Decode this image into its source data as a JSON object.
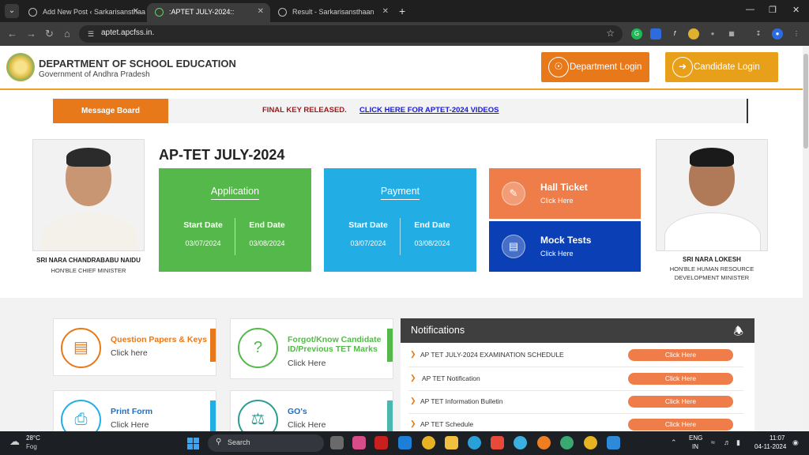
{
  "browser": {
    "tabs": [
      {
        "label": "Add New Post ‹ Sarkarisansthaan"
      },
      {
        "label": ":APTET JULY-2024::"
      },
      {
        "label": "Result - Sarkarisansthaan"
      }
    ],
    "url": "aptet.apcfss.in."
  },
  "header": {
    "department": "DEPARTMENT OF SCHOOL EDUCATION",
    "government": "Government of Andhra Pradesh",
    "department_login": "Department Login",
    "candidate_login": "Candidate Login"
  },
  "message_board": {
    "label": "Message Board",
    "notice": "FINAL KEY RELEASED.",
    "link": "CLICK HERE FOR APTET-2024 VIDEOS"
  },
  "left_person": {
    "name": "SRI NARA CHANDRABABU NAIDU",
    "role": "HON'BLE CHIEF MINISTER"
  },
  "right_person": {
    "name": "SRI NARA LOKESH",
    "role_line1": "HON'BLE HUMAN RESOURCE",
    "role_line2": "DEVELOPMENT MINISTER"
  },
  "exam_title": "AP-TET JULY-2024",
  "application": {
    "title": "Application",
    "start_label": "Start Date",
    "end_label": "End Date",
    "start": "03/07/2024",
    "end": "03/08/2024"
  },
  "payment": {
    "title": "Payment",
    "start_label": "Start Date",
    "end_label": "End Date",
    "start": "03/07/2024",
    "end": "03/08/2024"
  },
  "hall_ticket": {
    "title": "Hall Ticket",
    "sub": "Click Here"
  },
  "mock_tests": {
    "title": "Mock Tests",
    "sub": "Click Here"
  },
  "quick_links": {
    "question_papers": {
      "title": "Question Papers & Keys",
      "sub": "Click here"
    },
    "forgot_candidate": {
      "title": "Forgot/Know Candidate ID/Previous TET Marks",
      "sub": "Click Here"
    },
    "print_form": {
      "title": "Print Form",
      "sub": "Click Here"
    },
    "gos": {
      "title": "GO's",
      "sub": "Click Here"
    }
  },
  "notifications": {
    "title": "Notifications",
    "items": [
      {
        "text": "AP TET JULY-2024 EXAMINATION SCHEDULE",
        "button": "Click Here"
      },
      {
        "text": "AP TET Notification",
        "button": "Click Here"
      },
      {
        "text": "AP TET Information Bulletin",
        "button": "Click Here"
      },
      {
        "text": "AP TET Schedule",
        "button": "Click Here"
      }
    ]
  },
  "taskbar": {
    "temperature": "28°C",
    "condition": "Fog",
    "search_placeholder": "Search",
    "lang1": "ENG",
    "lang2": "IN",
    "time": "11:07",
    "date": "04-11-2024"
  },
  "colors": {
    "orange": "#e8791a",
    "gold": "#e8a01a",
    "green": "#55b84a",
    "cyan": "#22ade4",
    "navy": "#0a3fb5",
    "dark_header": "#3f3f3f"
  }
}
